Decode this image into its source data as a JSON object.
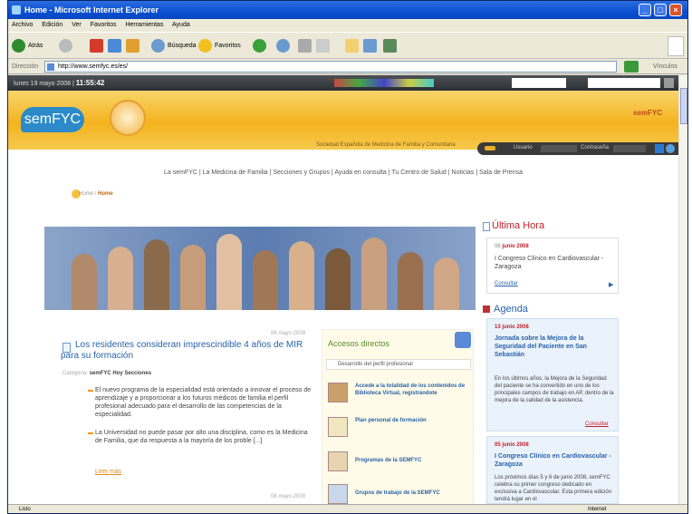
{
  "window": {
    "title": "Home - Microsoft Internet Explorer",
    "menu": [
      "Archivo",
      "Edición",
      "Ver",
      "Favoritos",
      "Herramientas",
      "Ayuda"
    ]
  },
  "toolbar": {
    "back_label": "Atrás",
    "search_label": "Búsqueda",
    "favorites_label": "Favoritos"
  },
  "address": {
    "label": "Dirección",
    "url": "http://www.semfyc.es/es/",
    "links_label": "Vínculos"
  },
  "site": {
    "date_prefix": "lunes 19 mayo 2008 |",
    "time": "11:55:42",
    "logo": "semFYC",
    "brand_small": "semFYC",
    "tagline": "Sociedad Española de Medicina de Familia y Comunitaria",
    "login_user_label": "Usuario",
    "login_password_label": "Contraseña",
    "nav": "La semFYC | La Medicina de Familia | Secciones y Grupos | Ayuda en consulta | Tu Centro de Salud | Noticias | Sala de Prensa",
    "breadcrumb_base": "Home /",
    "breadcrumb_current": "Home"
  },
  "news": {
    "date": "06 mayo 2008",
    "title": "Los residentes consideran imprescindible 4 años de MIR para su formación",
    "category_label": "Categoría:",
    "category": "semFYC Hoy Secciones",
    "p1": "El nuevo programa de la especialidad está orientado a innovar el proceso de aprendizaje y a proporcionar a los futuros médicos de familia el perfil profesional adecuado para el desarrollo de las competencias de la especialidad.",
    "p2": "La Universidad no puede pasar por alto una disciplina, como es la Medicina de Familia, que da respuesta a la mayoría de los proble [...]",
    "more": "Leer más",
    "date2": "08 mayo 2008"
  },
  "accesos": {
    "title": "Accesos directos",
    "subtitle": "Desarrollo del perfil profesional",
    "items": [
      "Accede a la totalidad de los contenidos de Biblioteca Virtual, registrándote",
      "Plan personal de formación",
      "Programas de la SEMFYC",
      "Grupos de trabajo de la SEMFYC"
    ]
  },
  "ultima": {
    "title": "Última Hora",
    "date_day": "06",
    "date_month": "junio 2008",
    "text": "I Congreso Clínico en Cardiovascular - Zaragoza",
    "link": "Consultar"
  },
  "agenda": {
    "title": "Agenda",
    "e1_date": "13 junio 2008",
    "e1_title": "Jornada sobre la Mejora de la Seguridad del Paciente en San Sebastián",
    "e1_text": "En los últimos años, la Mejora de la Seguridad del paciente se ha convertido en uno de los principales campos de trabajo en AP, dentro de la mejora de la calidad de la asistencia.",
    "e1_link": "Consultar",
    "e2_date": "05 junio 2008",
    "e2_title": "I Congreso Clínico en Cardiovascular - Zaragoza",
    "e2_text": "Los próximos días 5 y 6 de junio 2008, semFYC celebra su primer congreso dedicado en exclusiva a Cardiovascular. Esta primera edición tendrá lugar en el"
  },
  "status": {
    "left": "Listo",
    "zone": "Internet"
  }
}
